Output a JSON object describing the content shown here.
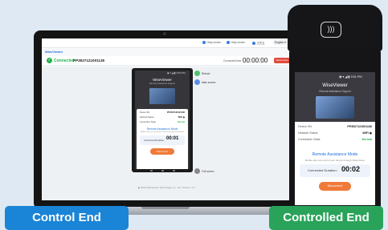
{
  "laptop": {
    "brand": "WiseViewer",
    "topbar": {
      "items": [
        {
          "label": "Help center"
        },
        {
          "label": "Help center"
        },
        {
          "label": "王先生"
        }
      ],
      "language": "English ▾"
    },
    "connection": {
      "status": "Connected",
      "serial": "PP3527121001136",
      "duration_label": "Connected time",
      "duration": "00:00:00",
      "disconnect": "Disconnect"
    },
    "remote_screen": {
      "status": "◉ ▾ ◢ ▮ 3:50 PM",
      "title": "WiseViewer",
      "subtitle": "Remote Assistance Support",
      "rows": [
        {
          "label": "Device SN",
          "value": "PP3527121001136"
        },
        {
          "label": "Network Status",
          "value": "WiFi ◉"
        },
        {
          "label": "Connection State",
          "value": "Normal"
        }
      ],
      "mode_title": "Remote Assistance Mode",
      "mode_sub": "Mobile side can control your device through WiseViewer",
      "duration_label": "Connected Duration:",
      "duration": "00:01",
      "disconnect": "Disconnect"
    },
    "side_actions": [
      {
        "label": "Reboot",
        "icon": "reboot-icon",
        "color": "#4fc36b"
      },
      {
        "label": "Main screen",
        "icon": "home-icon",
        "color": "#5b8de6"
      },
      {
        "label": "Full screen",
        "icon": "fullscreen-icon",
        "color": "#888888"
      }
    ],
    "footer": "◉ 2023 Wisedevice Technology Co., Ltd. Version: 1.0"
  },
  "pos": {
    "status": "◉ ▾ ◢ ▮ 3:51 PM",
    "title": "WiseViewer",
    "subtitle": "Remote Assistance Support",
    "rows": [
      {
        "label": "Device SN",
        "value": "PP3527121001136"
      },
      {
        "label": "Network Status",
        "value": "WiFi ◉"
      },
      {
        "label": "Connection State",
        "value": "Normal"
      }
    ],
    "mode_title": "Remote Assistance Mode",
    "mode_sub": "Mobile side can control your device through WiseViewer",
    "duration_label": "Connected Duration:",
    "duration": "00:02",
    "disconnect": "Disconnect"
  },
  "labels": {
    "control": "Control End",
    "controlled": "Controlled End"
  },
  "colors": {
    "accent_blue": "#1a84d6",
    "accent_green": "#2aa35a",
    "connected_green": "#22b14c",
    "disconnect_red": "#e04a3c",
    "disconnect_orange": "#f07a3a"
  }
}
